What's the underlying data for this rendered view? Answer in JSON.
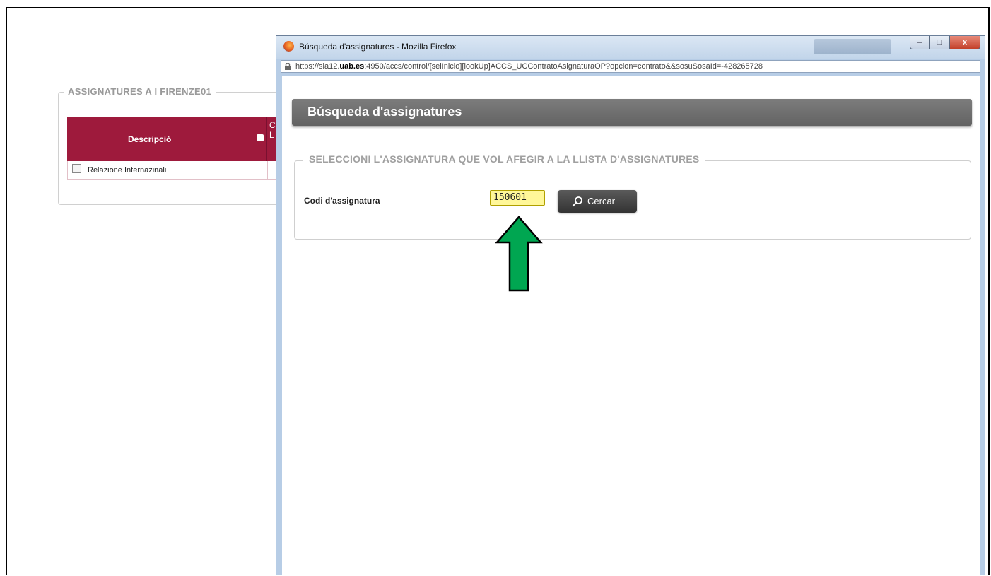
{
  "background_page": {
    "section_title": "ASSIGNATURES A I FIRENZE01",
    "table": {
      "col1_header": "Descripció",
      "col2_header_partial": "C\nL",
      "rows": [
        {
          "descripcio": "Relazione Internazinali"
        }
      ]
    }
  },
  "browser_window": {
    "title": "Búsqueda d'assignatures  - Mozilla Firefox",
    "url_prefix": "https://sia12.",
    "url_domain": "uab.es",
    "url_suffix": ":4950/accs/control/[selInicio][lookUp]ACCS_UCContratoAsignaturaOP?opcion=contrato&&sosuSosaId=-428265728",
    "controls": {
      "minimize": "–",
      "maximize": "□",
      "close": "x"
    }
  },
  "dialog": {
    "header_title": "Búsqueda d'assignatures",
    "fieldset_legend": "SELECCIONI L'ASSIGNATURA QUE VOL AFEGIR A LA LLISTA D'ASSIGNATURES",
    "code_label": "Codi d'assignatura",
    "code_value": "150601",
    "search_button_label": "Cercar"
  },
  "annotation": {
    "arrow_color": "#00a651",
    "icon": "up-arrow-icon"
  },
  "colors": {
    "table_header": "#9e1a3c",
    "dialog_header": "#6e6e6e",
    "input_highlight": "#fff799"
  }
}
